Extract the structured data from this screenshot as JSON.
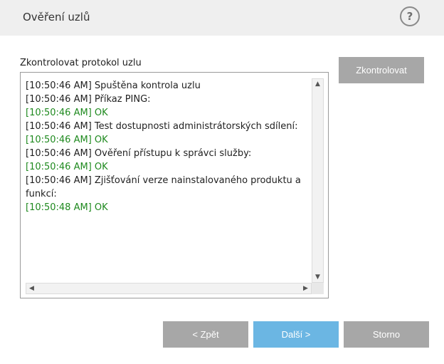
{
  "header": {
    "title": "Ověření uzlů",
    "help_icon": "?"
  },
  "log": {
    "label": "Zkontrolovat protokol uzlu",
    "lines": [
      {
        "text": "[10:50:46 AM] Spuštěna kontrola uzlu",
        "status": "normal"
      },
      {
        "text": "[10:50:46 AM] Příkaz PING:",
        "status": "normal"
      },
      {
        "text": "[10:50:46 AM] OK",
        "status": "ok"
      },
      {
        "text": "[10:50:46 AM] Test dostupnosti administrátorských sdílení:",
        "status": "normal"
      },
      {
        "text": "[10:50:46 AM] OK",
        "status": "ok"
      },
      {
        "text": "[10:50:46 AM] Ověření přístupu k správci služby:",
        "status": "normal"
      },
      {
        "text": "[10:50:46 AM] OK",
        "status": "ok"
      },
      {
        "text": "[10:50:46 AM] Zjišťování verze nainstalovaného produktu a funkcí:",
        "status": "normal"
      },
      {
        "text": "[10:50:48 AM] OK",
        "status": "ok"
      }
    ]
  },
  "buttons": {
    "check": "Zkontrolovat",
    "back": "< Zpět",
    "next": "Další >",
    "cancel": "Storno"
  },
  "colors": {
    "ok_text": "#1f8a1f",
    "primary_button": "#6bb6e3",
    "secondary_button": "#a7a7a7",
    "header_bg": "#efefef"
  }
}
